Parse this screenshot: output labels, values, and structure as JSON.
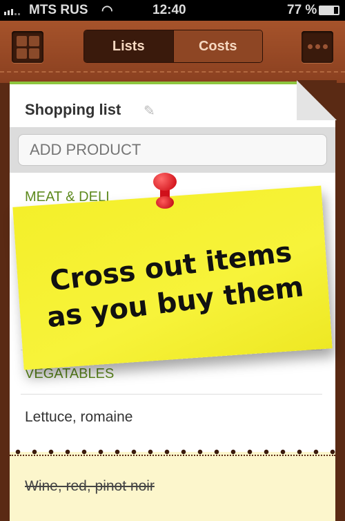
{
  "status": {
    "carrier": "MTS RUS",
    "time": "12:40",
    "battery": "77 %",
    "battery_level": 0.77
  },
  "header": {
    "tabs": [
      {
        "label": "Lists",
        "selected": true
      },
      {
        "label": "Costs",
        "selected": false
      }
    ],
    "left_icon": "grid-icon",
    "right_icon": "more-icon"
  },
  "list": {
    "title": "Shopping list",
    "add_placeholder": "ADD PRODUCT",
    "categories": [
      {
        "name": "MEAT & DELI"
      },
      {
        "name": "VEGATABLES",
        "items": [
          "Lettuce, romaine"
        ]
      }
    ],
    "purchased": [
      "Wine, red, pinot noir"
    ]
  },
  "note": {
    "line1": "Cross out items",
    "line2": "as you buy them"
  },
  "colors": {
    "accent": "#8dc63f",
    "category": "#5e8a1e",
    "note": "#f4ef2a",
    "leather": "#8a4020"
  }
}
